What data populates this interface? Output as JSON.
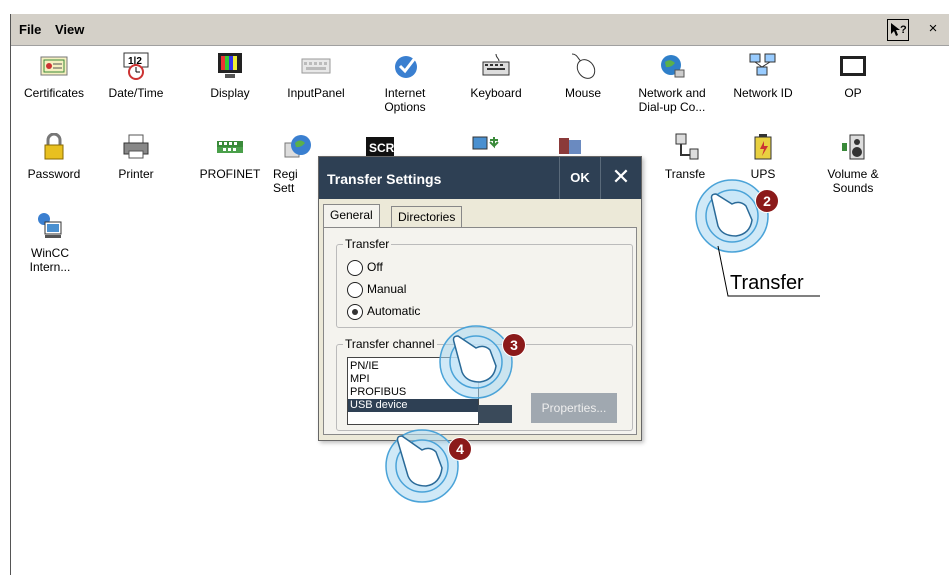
{
  "menubar": {
    "file": "File",
    "view": "View",
    "help": "?",
    "close": "×"
  },
  "control_panel": [
    {
      "label": "Certificates",
      "icon": "certificate-icon"
    },
    {
      "label": "Date/Time",
      "icon": "clock-icon"
    },
    {
      "label": "Display",
      "icon": "monitor-icon"
    },
    {
      "label": "InputPanel",
      "icon": "keyboard-panel-icon"
    },
    {
      "label": "Internet\nOptions",
      "icon": "globe-check-icon"
    },
    {
      "label": "Keyboard",
      "icon": "keyboard-icon"
    },
    {
      "label": "Mouse",
      "icon": "mouse-icon"
    },
    {
      "label": "Network and\nDial-up Co...",
      "icon": "network-globe-icon"
    },
    {
      "label": "Network ID",
      "icon": "network-computers-icon"
    },
    {
      "label": "OP",
      "icon": "op-screen-icon"
    },
    {
      "label": "Password",
      "icon": "lock-icon"
    },
    {
      "label": "Printer",
      "icon": "printer-icon"
    },
    {
      "label": "PROFINET",
      "icon": "profinet-icon"
    },
    {
      "label": "Regi\nSett",
      "icon": "regional-globe-icon"
    },
    {
      "label": "SCR",
      "icon": "screensaver-icon"
    },
    {
      "label": "",
      "icon": "monitor-arrow-icon"
    },
    {
      "label": "",
      "icon": "system-icon"
    },
    {
      "label": "Transfe",
      "icon": "transfer-icon"
    },
    {
      "label": "UPS",
      "icon": "battery-icon"
    },
    {
      "label": "Volume &\nSounds",
      "icon": "speaker-icon"
    },
    {
      "label": "WinCC\nIntern...",
      "icon": "wincc-internet-icon"
    }
  ],
  "dialog": {
    "title": "Transfer Settings",
    "ok": "OK",
    "tabs": [
      "General",
      "Directories"
    ],
    "transfer_group": "Transfer",
    "radios": [
      "Off",
      "Manual",
      "Automatic"
    ],
    "selected_radio": "Automatic",
    "channel_group": "Transfer channel",
    "channels": [
      "PN/IE",
      "MPI",
      "PROFIBUS",
      "USB device"
    ],
    "selected_channel": "USB device",
    "properties": "Properties..."
  },
  "callouts": [
    "2",
    "3",
    "4"
  ],
  "tooltip_label": "Transfer",
  "colors": {
    "title_bar": "#2e4054",
    "callout": "#8b1a1a",
    "menubar": "#d4d0c8",
    "hand": "#4aa3d8"
  }
}
